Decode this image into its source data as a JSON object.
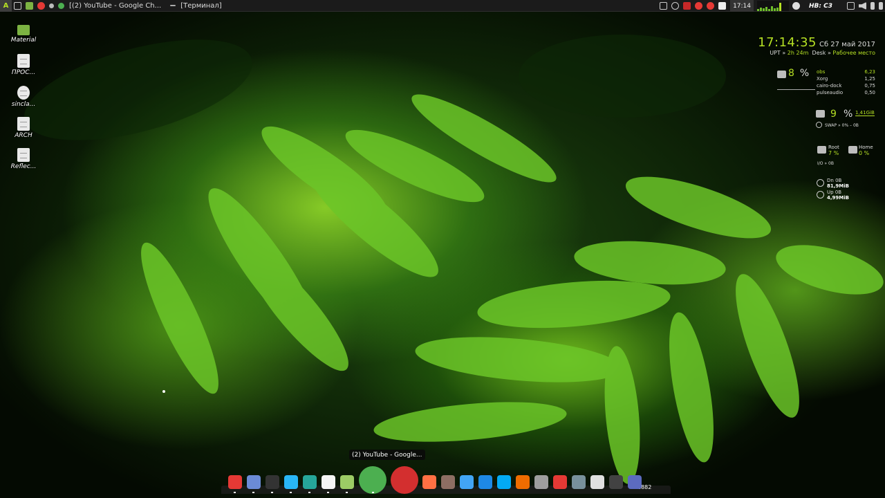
{
  "top_panel": {
    "menu_glyph": "A",
    "tasks": [
      "[(2) YouTube - Google Ch...",
      "[Терминал]"
    ],
    "clock": "17:14",
    "disk_label": "НВ: С3",
    "icons": [
      "menu-icon",
      "terminal-icon",
      "browser-icon",
      "file-manager-icon",
      "chrome-icon",
      "settings-icon",
      "battery-icon",
      "network-icon",
      "volume-icon",
      "chat-icon"
    ]
  },
  "desktop_icons": [
    {
      "label": "Material",
      "icon": "folder-icon"
    },
    {
      "label": "ПРОС...",
      "icon": "document-icon"
    },
    {
      "label": "sincla...",
      "icon": "disc-icon"
    },
    {
      "label": "ARCH",
      "icon": "document-icon"
    },
    {
      "label": "Reflec...",
      "icon": "document-icon"
    }
  ],
  "conky": {
    "time": "17:14:35",
    "date": "Сб 27 май 2017",
    "uptime_label": "UPT »",
    "uptime_value": "2h 24m",
    "desk_label": "Desk »",
    "desk_value": "Рабочее место",
    "cpu_percent": "8",
    "percent_sign": "%",
    "processes": [
      {
        "name": "obs",
        "value": "6,23"
      },
      {
        "name": "Xorg",
        "value": "1,25"
      },
      {
        "name": "cairo-dock",
        "value": "0,75"
      },
      {
        "name": "pulseaudio",
        "value": "0,50"
      }
    ],
    "ram_percent": "9",
    "ram_size": "1,41GiB",
    "swap": "SWAP » 0% – 0B",
    "root_label": "Root",
    "root_percent": "7 %",
    "home_label": "Home",
    "home_percent": "0 %",
    "io": "I/O » 0B",
    "down_label": "Dn",
    "down_value": "0B",
    "down_total": "81,9MiB",
    "up_label": "Up",
    "up_value": "0B",
    "up_total": "4,99MiB"
  },
  "dock": {
    "tooltip": "(2) YouTube - Google...",
    "badge": "1882",
    "items": [
      {
        "name": "app-grid-icon",
        "color": "#e53935"
      },
      {
        "name": "messenger-icon",
        "color": "#6b8bd6"
      },
      {
        "name": "terminal-icon",
        "color": "#333333"
      },
      {
        "name": "download-icon",
        "color": "#29b6f6"
      },
      {
        "name": "screenshot-icon",
        "color": "#26a69a"
      },
      {
        "name": "notes-icon",
        "color": "#f5f5f5"
      },
      {
        "name": "files-icon",
        "color": "#9ccc65"
      },
      {
        "name": "chrome-icon",
        "color": "#4caf50"
      },
      {
        "name": "opera-icon",
        "color": "#d32f2f"
      },
      {
        "name": "firefox-icon",
        "color": "#ff7043"
      },
      {
        "name": "mail-icon",
        "color": "#8d6e63"
      },
      {
        "name": "monitor-icon",
        "color": "#42a5f5"
      },
      {
        "name": "chat-icon",
        "color": "#1e88e5"
      },
      {
        "name": "skype-icon",
        "color": "#03a9f4"
      },
      {
        "name": "paint-icon",
        "color": "#ef6c00"
      },
      {
        "name": "trash-icon",
        "color": "#9e9e9e"
      },
      {
        "name": "gmail-icon",
        "color": "#e53935"
      },
      {
        "name": "network-icon",
        "color": "#78909c"
      },
      {
        "name": "brightness-icon",
        "color": "#e0e0e0"
      },
      {
        "name": "power-icon",
        "color": "#424242"
      },
      {
        "name": "update-icon",
        "color": "#5c6bc0"
      }
    ]
  }
}
